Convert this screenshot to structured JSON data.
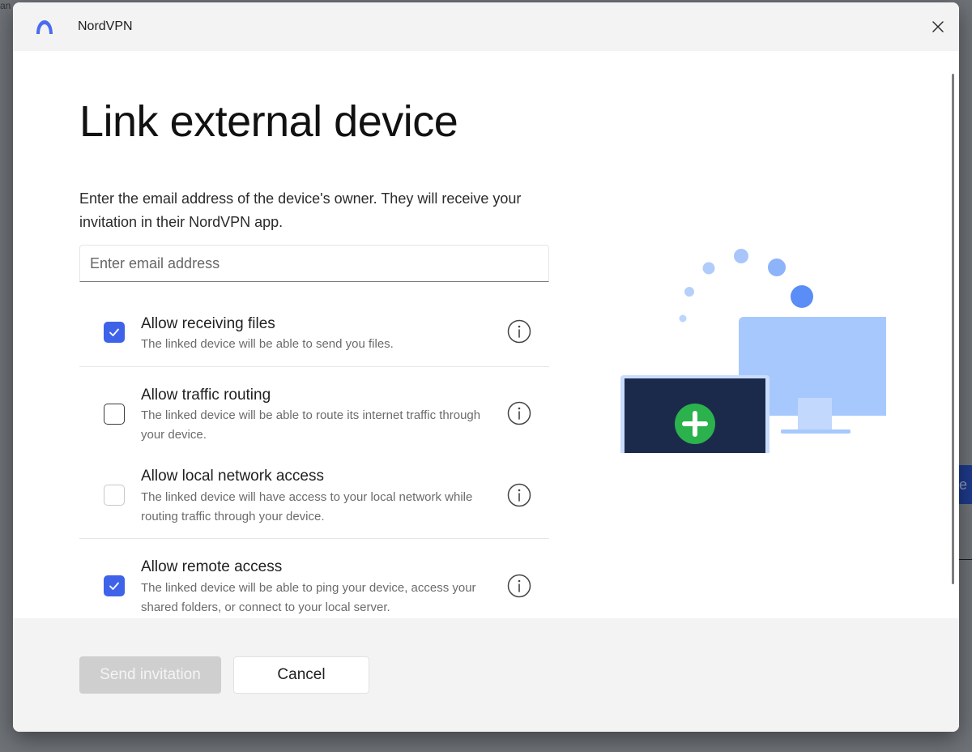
{
  "window": {
    "app_name": "NordVPN",
    "close_icon": "close-icon"
  },
  "page": {
    "title": "Link external device",
    "description": "Enter the email address of the device's owner. They will receive your invitation in their NordVPN app."
  },
  "email": {
    "placeholder": "Enter email address",
    "value": ""
  },
  "options": [
    {
      "title": "Allow receiving files",
      "description": "The linked device will be able to send you files.",
      "checked": true,
      "enabled": true
    },
    {
      "title": "Allow traffic routing",
      "description": "The linked device will be able to route its internet traffic through your device.",
      "checked": false,
      "enabled": true
    },
    {
      "title": "Allow local network access",
      "description": "The linked device will have access to your local network while routing traffic through your device.",
      "checked": false,
      "enabled": false
    },
    {
      "title": "Allow remote access",
      "description": "The linked device will be able to ping your device, access your shared folders, or connect to your local server.",
      "checked": true,
      "enabled": true
    }
  ],
  "footer": {
    "send_label": "Send invitation",
    "cancel_label": "Cancel"
  },
  "colors": {
    "accent": "#3f63e8",
    "plus_green": "#2bb24c",
    "monitor_front": "#1b2a4a",
    "monitor_back": "#9fc3fb",
    "disabled_button": "#cfcfcf"
  }
}
